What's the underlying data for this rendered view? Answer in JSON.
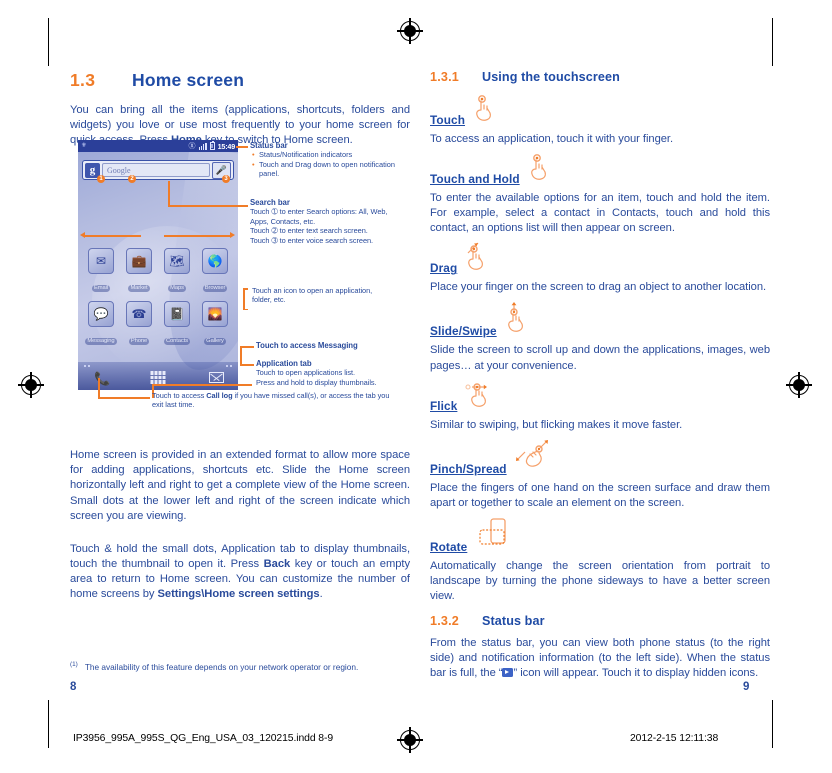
{
  "left_column": {
    "heading": {
      "number": "1.3",
      "title": "Home screen"
    },
    "intro": "You can bring all the items (applications, shortcuts, folders and widgets) you love or use most frequently to your home screen for quick access. Press <b>Home</b> key to switch to Home screen.",
    "para_extended": "Home screen is provided in an extended format to allow more space for adding applications, shortcuts etc. Slide the Home screen horizontally left and right to get a complete view of the Home screen. Small dots at the lower left and right of the screen indicate which screen you are viewing.",
    "para_thumbnails": "Touch &amp; hold the small dots, Application tab to display thumbnails, touch the thumbnail to open it. Press <b>Back</b> key or touch an empty area to return to Home screen. You can customize the number of home screens by <b>Settings\\Home screen settings</b>."
  },
  "annotations": {
    "status_bar": {
      "title": "Status bar",
      "bullets": [
        "Status/Notification indicators",
        "Touch and Drag down to open notification panel."
      ]
    },
    "search_bar": {
      "title": "Search bar",
      "lines": [
        "Touch ➀ to enter Search options: All, Web, Apps, Contacts, etc.",
        "Touch ➁ to enter text search screen.",
        "Touch ➂ to enter voice search screen."
      ]
    },
    "icon_note": "Touch an icon to open an application, folder, etc.",
    "messaging_note": "Touch to access <b>Messaging</b>",
    "application_tab": {
      "title": "Application tab",
      "lines": [
        "Touch to open applications list.",
        "Press and hold to display thumbnails."
      ]
    },
    "call_log_note": "Touch to access <b>Call log</b> if you have missed call(s), or access the tab you exit last time."
  },
  "phone_screen": {
    "status_bar": {
      "time": "15:49",
      "icons": [
        "bluetooth-icon",
        "signal-bars-icon",
        "battery-icon"
      ],
      "left_icon": "notification-icon"
    },
    "search_bar": {
      "google_badge": "g",
      "placeholder": "Google",
      "mic_icon": "microphone-icon",
      "callouts": [
        "1",
        "2",
        "3"
      ]
    },
    "apps_row_1": [
      {
        "label": "Email",
        "icon": "email-icon"
      },
      {
        "label": "Market",
        "icon": "market-bag-icon"
      },
      {
        "label": "Maps",
        "icon": "maps-icon"
      },
      {
        "label": "Browser",
        "icon": "globe-icon"
      }
    ],
    "apps_row_2": [
      {
        "label": "Messaging",
        "icon": "speech-bubble-icon"
      },
      {
        "label": "Phone",
        "icon": "handset-icon"
      },
      {
        "label": "Contacts",
        "icon": "contacts-card-icon"
      },
      {
        "label": "Gallery",
        "icon": "picture-icon"
      }
    ],
    "dock": {
      "left_icon": "phone-handset-icon",
      "center_icon": "application-tab-grid-icon",
      "right_icon": "envelope-icon"
    }
  },
  "right_column": {
    "heading_touchscreen": {
      "number": "1.3.1",
      "title": "Using the touchscreen"
    },
    "gestures": [
      {
        "name": "Touch",
        "icon": "hand-touch-icon",
        "text": "To access an application, touch it with your finger."
      },
      {
        "name": "Touch and Hold",
        "icon": "hand-touch-hold-icon",
        "text": "To enter the available options for an item, touch and hold the item. For example, select a contact in Contacts, touch and hold this contact, an options list will then appear on screen."
      },
      {
        "name": "Drag",
        "icon": "hand-drag-icon",
        "text": "Place your finger on the screen to drag an object to another location."
      },
      {
        "name": "Slide/Swipe",
        "icon": "hand-slide-icon",
        "text": "Slide the screen to scroll up and down the applications, images, web pages… at your convenience."
      },
      {
        "name": "Flick",
        "icon": "hand-flick-icon",
        "text": "Similar to swiping, but flicking makes it move faster."
      },
      {
        "name": "Pinch/Spread",
        "icon": "hand-pinch-icon",
        "text": "Place the fingers of one hand on the screen surface and draw them apart or together to scale an element on the screen."
      },
      {
        "name": "Rotate",
        "icon": "phone-rotate-icon",
        "text": "Automatically change the screen orientation from portrait to landscape by turning the phone sideways to have a better screen view."
      }
    ],
    "heading_statusbar": {
      "number": "1.3.2",
      "title": "Status bar"
    },
    "statusbar_text_1": "From the status bar, you can view both phone status (to the right side) and notification information (to the left side). When the status bar is full, the “",
    "statusbar_text_2": "”  icon will appear. Touch it to display hidden icons."
  },
  "footer": {
    "footnote_marker": "(1)",
    "footnote_text": "The availability of this feature depends on your network operator or region.",
    "page_left": "8",
    "page_right": "9",
    "print_filename": "IP3956_995A_995S_QG_Eng_USA_03_120215.indd   8-9",
    "print_timestamp": "2012-2-15   12:11:38"
  },
  "colors": {
    "orange": "#F07C28",
    "blue": "#1F4BA5",
    "body_blue": "#2A4B9B",
    "phone_ui_blue": "#2b3f99"
  }
}
